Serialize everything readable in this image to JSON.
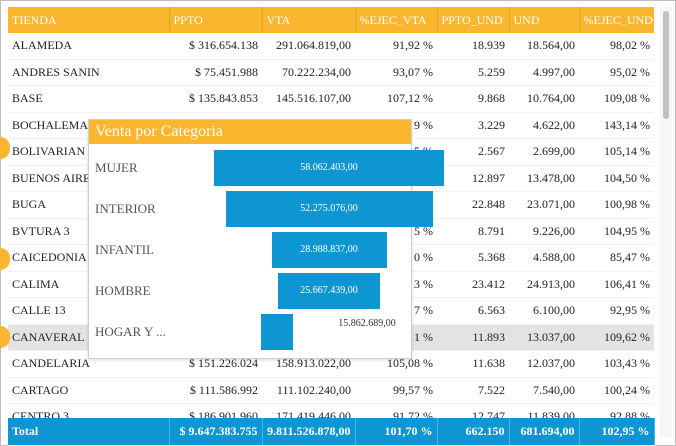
{
  "table": {
    "columns": [
      "TIENDA",
      "PPTO",
      "VTA",
      "%EJEC_VTA",
      "PPTO_UND",
      "UND",
      "%EJEC_UND"
    ],
    "rows": [
      [
        "ALAMEDA",
        "$ 316.654.138",
        "291.064.819,00",
        "91,92 %",
        "18.939",
        "18.564,00",
        "98,02 %"
      ],
      [
        "ANDRES SANIN",
        "$ 75.451.988",
        "70.222.234,00",
        "93,07 %",
        "5.259",
        "4.997,00",
        "95,02 %"
      ],
      [
        "BASE",
        "$ 135.843.853",
        "145.516.107,00",
        "107,12 %",
        "9.868",
        "10.764,00",
        "109,08 %"
      ],
      [
        "BOCHALEMA",
        "",
        "",
        "9 %",
        "3.229",
        "4.622,00",
        "143,14 %"
      ],
      [
        "BOLIVARIAN",
        "",
        "",
        "5 %",
        "2.567",
        "2.699,00",
        "105,14 %"
      ],
      [
        "BUENOS AIRE",
        "",
        "",
        "8 %",
        "12.897",
        "13.478,00",
        "104,50 %"
      ],
      [
        "BUGA",
        "",
        "",
        "5 %",
        "22.848",
        "23.071,00",
        "100,98 %"
      ],
      [
        "BVTURA 3",
        "",
        "",
        "5 %",
        "8.791",
        "9.226,00",
        "104,95 %"
      ],
      [
        "CAICEDONIA",
        "",
        "",
        "0 %",
        "5.368",
        "4.588,00",
        "85,47 %"
      ],
      [
        "CALIMA",
        "",
        "",
        "3 %",
        "23.412",
        "24.913,00",
        "106,41 %"
      ],
      [
        "CALLE 13",
        "",
        "",
        "7 %",
        "6.563",
        "6.100,00",
        "92,95 %"
      ],
      [
        "CANAVERAL",
        "",
        "",
        "1 %",
        "11.893",
        "13.037,00",
        "109,62 %"
      ],
      [
        "CANDELARIA",
        "$ 151.226.024",
        "158.913.022,00",
        "105,08 %",
        "11.638",
        "12.037,00",
        "103,43 %"
      ],
      [
        "CARTAGO",
        "$ 111.586.992",
        "111.102.240,00",
        "99,57 %",
        "7.522",
        "7.540,00",
        "100,24 %"
      ],
      [
        "CENTRO 3",
        "$ 186.901.960",
        "171.419.446,00",
        "91,72 %",
        "12.747",
        "11.839,00",
        "92,88 %"
      ]
    ],
    "total": [
      "Total",
      "$ 9.647.383.755",
      "9.811.526.878,00",
      "101,70 %",
      "662.150",
      "681.694,00",
      "102,95 %"
    ]
  },
  "popup": {
    "title": "Venta por Categoria",
    "chart_data": {
      "type": "funnel",
      "categories": [
        "MUJER",
        "INTERIOR",
        "INFANTIL",
        "HOMBRE",
        "HOGAR Y ..."
      ],
      "values": [
        58062403,
        52275076,
        28988837,
        25667439,
        15862689
      ],
      "value_labels": [
        "58.062.403,00",
        "52.275.076,00",
        "28.988.837,00",
        "25.667.439,00",
        "15.862.689,00"
      ]
    }
  },
  "colors": {
    "header": "#fbb62f",
    "accent": "#0e96d2",
    "highlight": "#e3e3e3"
  }
}
